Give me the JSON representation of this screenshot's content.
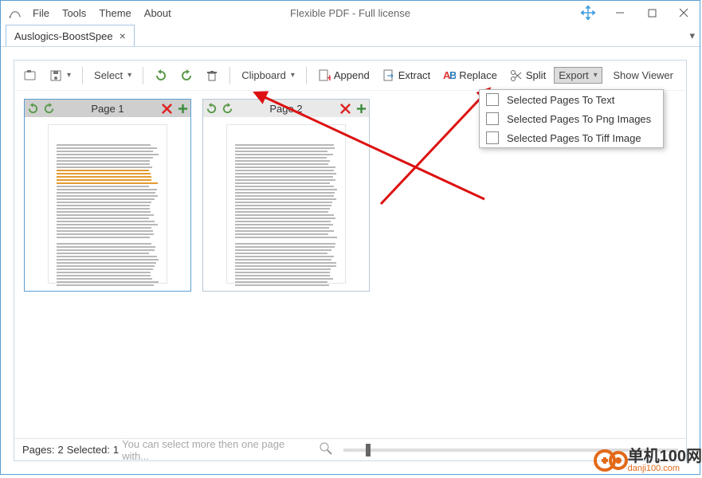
{
  "menu": {
    "file": "File",
    "tools": "Tools",
    "theme": "Theme",
    "about": "About"
  },
  "title": "Flexible PDF - Full license",
  "tab": {
    "label": "Auslogics-BoostSpee"
  },
  "toolbar": {
    "select": "Select",
    "clipboard": "Clipboard",
    "append": "Append",
    "extract": "Extract",
    "replace": "Replace",
    "split": "Split",
    "export": "Export",
    "show_viewer": "Show Viewer"
  },
  "pages": [
    {
      "title": "Page 1",
      "selected": true,
      "highlight": true
    },
    {
      "title": "Page 2",
      "selected": false,
      "highlight": false
    }
  ],
  "export_menu": {
    "text": "Selected Pages To Text",
    "png": "Selected Pages To Png Images",
    "tiff": "Selected Pages To Tiff Image"
  },
  "status": {
    "pages_label": "Pages:",
    "pages_value": "2",
    "selected_label": "Selected:",
    "selected_value": "1",
    "hint": "You can select more then one page with..."
  },
  "watermark": {
    "cn": "单机100网",
    "en": "danji100.com"
  }
}
